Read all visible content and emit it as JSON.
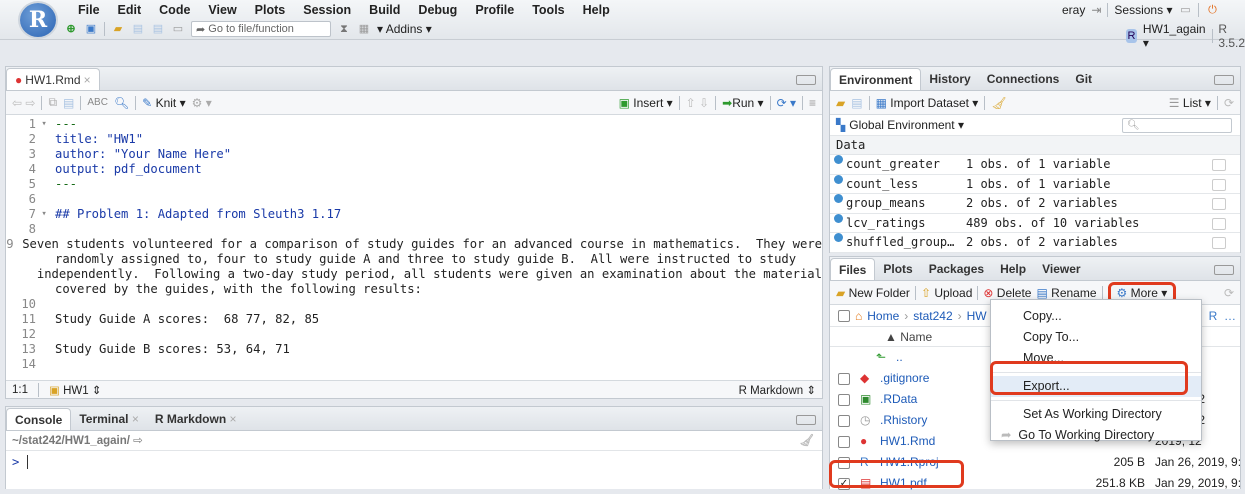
{
  "menubar": {
    "items": [
      "File",
      "Edit",
      "Code",
      "View",
      "Plots",
      "Session",
      "Build",
      "Debug",
      "Profile",
      "Tools",
      "Help"
    ],
    "user": "eray",
    "sessions": "Sessions",
    "goto_placeholder": "Go to file/function",
    "addins": "Addins",
    "project": "HW1_again",
    "rversion": "R 3.5.2"
  },
  "editor": {
    "tab": "HW1.Rmd",
    "knit": "Knit",
    "insert": "Insert",
    "run": "Run",
    "lines": [
      {
        "n": "1",
        "t": "---",
        "c": "green"
      },
      {
        "n": "2",
        "t": "title: \"HW1\"",
        "c": "blue"
      },
      {
        "n": "3",
        "t": "author: \"Your Name Here\"",
        "c": "blue"
      },
      {
        "n": "4",
        "t": "output: pdf_document",
        "c": "blue"
      },
      {
        "n": "5",
        "t": "---",
        "c": "green"
      },
      {
        "n": "6",
        "t": "",
        "c": ""
      },
      {
        "n": "7",
        "t": "## Problem 1: Adapted from Sleuth3 1.17",
        "c": "blue"
      },
      {
        "n": "8",
        "t": "",
        "c": ""
      },
      {
        "n": "9",
        "t": "Seven students volunteered for a comparison of study guides for an advanced course in mathematics.  They were",
        "c": ""
      },
      {
        "n": "",
        "t": "randomly assigned to, four to study guide A and three to study guide B.  All were instructed to study",
        "c": ""
      },
      {
        "n": "",
        "t": "independently.  Following a two-day study period, all students were given an examination about the material",
        "c": ""
      },
      {
        "n": "",
        "t": "covered by the guides, with the following results:",
        "c": ""
      },
      {
        "n": "10",
        "t": "",
        "c": ""
      },
      {
        "n": "11",
        "t": "Study Guide A scores:  68 77, 82, 85",
        "c": ""
      },
      {
        "n": "12",
        "t": "",
        "c": ""
      },
      {
        "n": "13",
        "t": "Study Guide B scores: 53, 64, 71",
        "c": ""
      },
      {
        "n": "14",
        "t": "",
        "c": ""
      }
    ],
    "status_pos": "1:1",
    "status_section": "HW1",
    "status_mode": "R Markdown"
  },
  "console": {
    "tabs": [
      "Console",
      "Terminal",
      "R Markdown"
    ],
    "path": "~/stat242/HW1_again/",
    "prompt": ">"
  },
  "env": {
    "tabs": [
      "Environment",
      "History",
      "Connections",
      "Git"
    ],
    "import": "Import Dataset",
    "list": "List",
    "scope": "Global Environment",
    "section": "Data",
    "rows": [
      {
        "name": "count_greater",
        "val": "1 obs. of 1 variable"
      },
      {
        "name": "count_less",
        "val": "1 obs. of 1 variable"
      },
      {
        "name": "group_means",
        "val": "2 obs. of 2 variables"
      },
      {
        "name": "lcv_ratings",
        "val": "489 obs. of 10 variables"
      },
      {
        "name": "shuffled_group…",
        "val": "2 obs. of 2 variables"
      }
    ]
  },
  "files": {
    "tabs": [
      "Files",
      "Plots",
      "Packages",
      "Help",
      "Viewer"
    ],
    "toolbar": {
      "new_folder": "New Folder",
      "upload": "Upload",
      "delete": "Delete",
      "rename": "Rename",
      "more": "More"
    },
    "crumbs": [
      "Home",
      "stat242",
      "HW"
    ],
    "col_name": "▲ Name",
    "rows": [
      {
        "name": "..",
        "size": "",
        "date": ""
      },
      {
        "name": ".gitignore",
        "size": "",
        "date": "2019, 12"
      },
      {
        "name": ".RData",
        "size": "",
        "date": "2019, 9:2"
      },
      {
        "name": ".Rhistory",
        "size": "",
        "date": "2019, 9:2"
      },
      {
        "name": "HW1.Rmd",
        "size": "",
        "date": "2019, 12"
      },
      {
        "name": "HW1.Rproj",
        "size": "205 B",
        "date": "Jan 26, 2019, 9:2"
      },
      {
        "name": "HW1.pdf",
        "size": "251.8 KB",
        "date": "Jan 29, 2019, 9:3"
      }
    ],
    "date_header": "d"
  },
  "more_menu": {
    "items": [
      "Copy...",
      "Copy To...",
      "Move...",
      "Export...",
      "Set As Working Directory",
      "Go To Working Directory"
    ]
  }
}
